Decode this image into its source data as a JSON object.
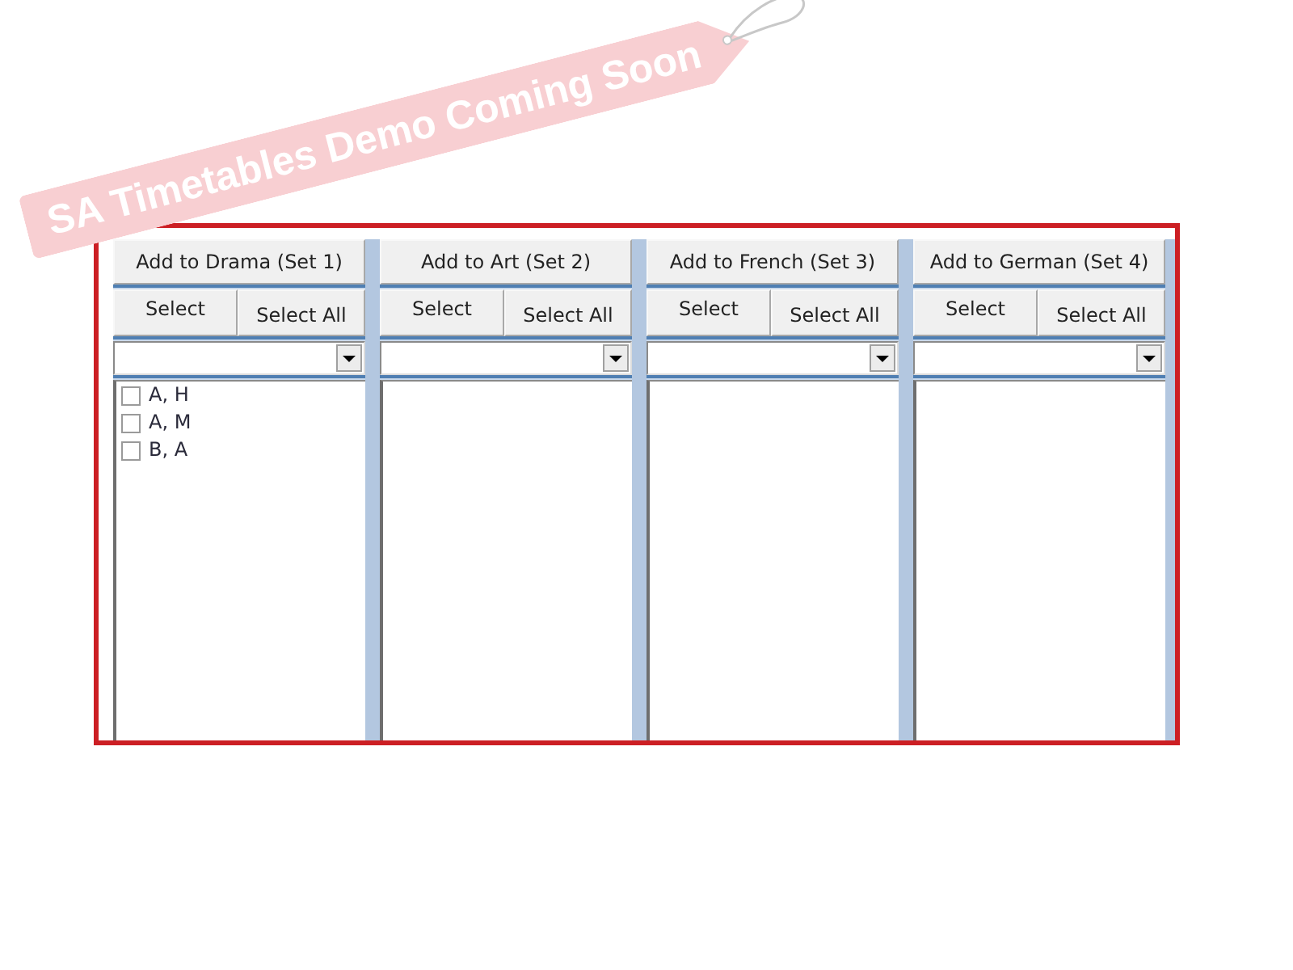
{
  "banner": {
    "text": "SA Timetables Demo Coming Soon"
  },
  "columns": [
    {
      "add_button": "Add to Drama (Set 1)",
      "select_button": "Select",
      "select_all_button": "Select All",
      "items": [
        {
          "label": "A, H",
          "checked": false
        },
        {
          "label": "A, M",
          "checked": false
        },
        {
          "label": "B, A",
          "checked": false
        }
      ]
    },
    {
      "add_button": "Add to Art (Set 2)",
      "select_button": "Select",
      "select_all_button": "Select All"
    },
    {
      "add_button": "Add to French (Set 3)",
      "select_button": "Select",
      "select_all_button": "Select All"
    },
    {
      "add_button": "Add to German (Set 4)",
      "select_button": "Select",
      "select_all_button": "Select All"
    }
  ]
}
